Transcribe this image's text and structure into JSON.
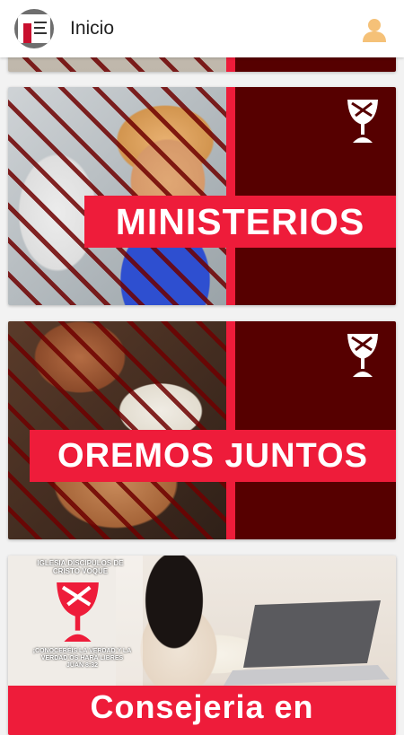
{
  "header": {
    "title": "Inicio"
  },
  "cards": [
    {
      "label": ""
    },
    {
      "label": "MINISTERIOS"
    },
    {
      "label": "OREMOS JUNTOS"
    },
    {
      "label": "Consejeria en",
      "poster_church": "IGLESIA DISCIPULOS DE CRISTO VOQUE",
      "poster_verse_line1": "¡CONOCERÉIS LA VERDAD Y LA",
      "poster_verse_line2": "VERDAD OS HARÁ LIBRES",
      "poster_verse_ref": "JUAN 8:32"
    }
  ],
  "colors": {
    "accent": "#ee1c3a",
    "dark_maroon": "#560000",
    "avatar": "#f5c178"
  }
}
